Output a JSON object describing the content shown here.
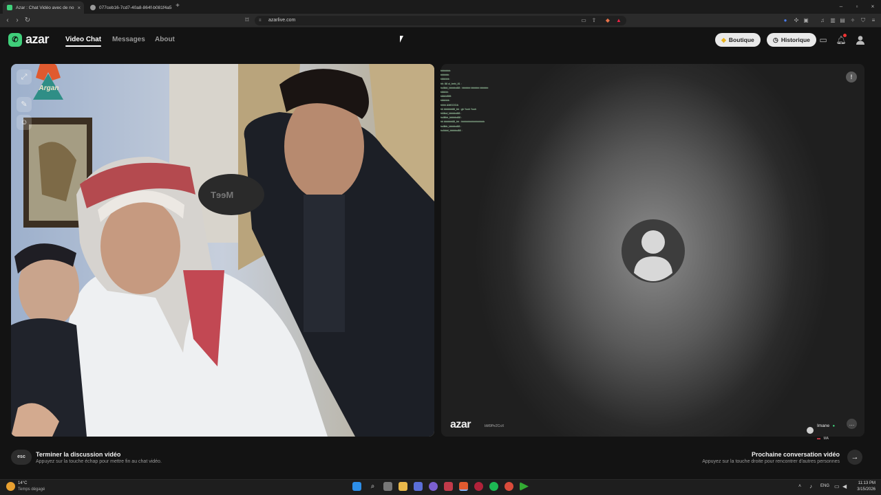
{
  "browser": {
    "tabs": [
      {
        "title": "Azar : Chat Vidéo avec de no",
        "active": true
      },
      {
        "title": "077ceb16-7cd7-40a8-864f-b081f4a5",
        "active": false
      }
    ],
    "new_tab": "+",
    "url": "azarlive.com"
  },
  "site": {
    "logo": "azar",
    "nav": {
      "video_chat": "Video Chat",
      "messages": "Messages",
      "about": "About"
    },
    "boutique": "Boutique",
    "historique": "Historique"
  },
  "local_video": {
    "overlay_logo": "Argan",
    "headphone_text": "MeeT"
  },
  "chat_log": [
    "bbbbbbb:",
    "bbbbbb:",
    "kkkkkkk:",
    "hh: 88 ol_bebi_81 :",
    "hollldd_bbbbbd88 : bbbbbb bbbbbb bbbbbb",
    "kkkkkk:",
    "kkkkk888:",
    "kkkkkkk:",
    "hhhh AMIGOOA",
    "hh bbbbbb88_bb : gh Yooh Yooh",
    "hhlllod_bbbbbd88 :",
    "hollllbb_bbbbbd88 :",
    "hh bbbbbb88_bb : hhhhhhhhhhhhhhhhh",
    "holllbb_bbbbbd88 :",
    "hollddd_bbbbbd88 :"
  ],
  "remote_video": {
    "watermark_logo": "azar",
    "watermark_id": "bM9Pe2CoX",
    "partner_name": "Imane",
    "partner_country": "MA"
  },
  "controls": {
    "esc_key": "esc",
    "end_title": "Terminer la discussion vidéo",
    "end_subtitle": "Appuyez sur la touche échap pour mettre fin au chat vidéo.",
    "next_title": "Prochaine conversation vidéo",
    "next_subtitle": "Appuyez sur la touche droite pour rencontrer d'autres personnes"
  },
  "taskbar": {
    "weather_temp": "14°C",
    "weather_desc": "Temps dégagé",
    "language": "ENG",
    "time": "11:13 PM",
    "date": "3/15/2026"
  },
  "icons": {
    "next": "arrow-right-icon",
    "report": "shield-icon",
    "chat": "chat-bubble-icon",
    "notifications": "bell-icon",
    "profile": "user-icon"
  },
  "colors": {
    "brand_green": "#3fcf7a",
    "background": "#131313",
    "pill": "#e9e9e9",
    "chat_text": "#b9f0c0"
  }
}
